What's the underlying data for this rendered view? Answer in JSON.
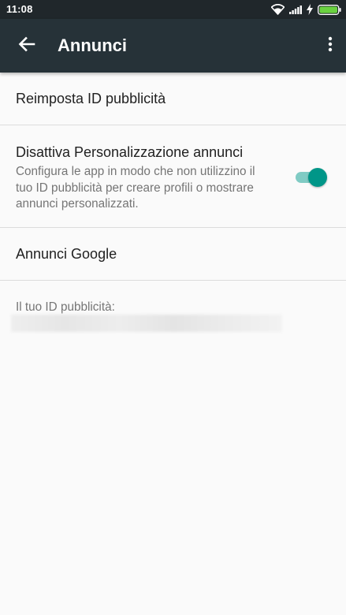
{
  "status_bar": {
    "time": "11:08",
    "icons": [
      "wifi-icon",
      "signal-icon",
      "charging-icon",
      "battery-icon"
    ],
    "battery_color": "#6ad140"
  },
  "app_bar": {
    "title": "Annunci",
    "back_icon": "arrow-left-icon",
    "overflow_icon": "more-vert-icon",
    "background": "#263238"
  },
  "settings": {
    "reset_id_label": "Reimposta ID pubblicità",
    "opt_out": {
      "title": "Disattiva Personalizzazione annunci",
      "summary": "Configura le app in modo che non utilizzino il tuo ID pubblicità per creare profili o mostrare annunci personalizzati.",
      "enabled": true,
      "accent_color": "#009688"
    },
    "google_ads_label": "Annunci Google",
    "ad_id_label": "Il tuo ID pubblicità:"
  }
}
